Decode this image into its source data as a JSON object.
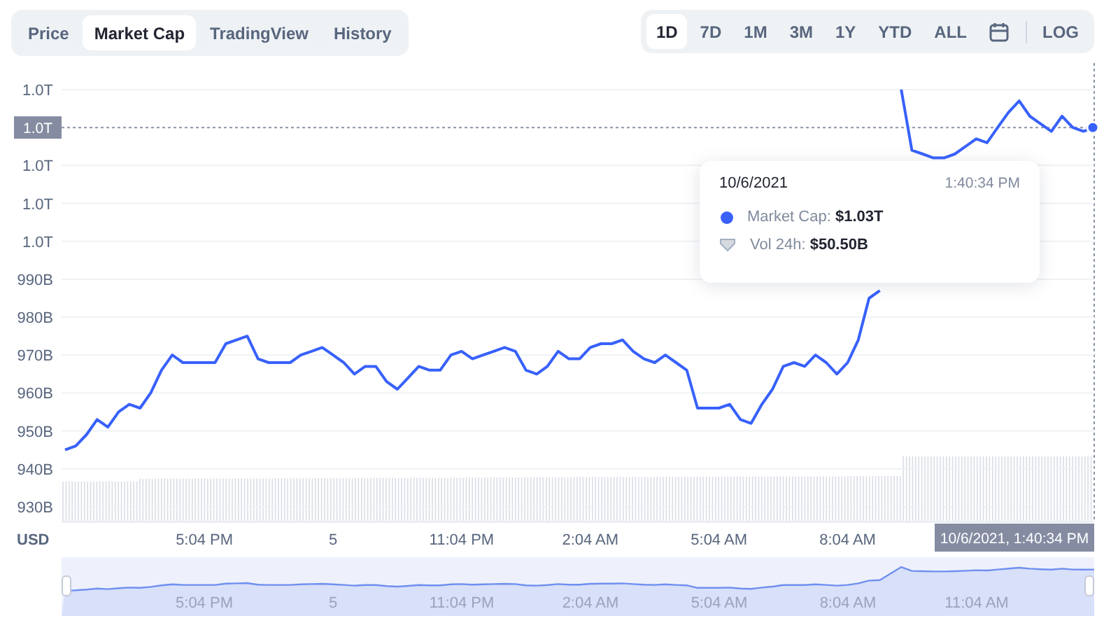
{
  "tabs": [
    {
      "label": "Price",
      "selected": false
    },
    {
      "label": "Market Cap",
      "selected": true
    },
    {
      "label": "TradingView",
      "selected": false
    },
    {
      "label": "History",
      "selected": false
    }
  ],
  "ranges": [
    {
      "label": "1D",
      "selected": true
    },
    {
      "label": "7D",
      "selected": false
    },
    {
      "label": "1M",
      "selected": false
    },
    {
      "label": "3M",
      "selected": false
    },
    {
      "label": "1Y",
      "selected": false
    },
    {
      "label": "YTD",
      "selected": false
    },
    {
      "label": "ALL",
      "selected": false
    }
  ],
  "scale_toggle": {
    "label": "LOG"
  },
  "chart": {
    "currency": "USD",
    "crosshair": {
      "y_label": "1.0T",
      "x_label": "10/6/2021, 1:40:34 PM"
    },
    "tooltip": {
      "date": "10/6/2021",
      "time": "1:40:34 PM",
      "rows": [
        {
          "kind": "series",
          "text": "Market Cap: **$1.03T**"
        },
        {
          "kind": "volume",
          "text": "Vol 24h: **$50.50B**"
        }
      ]
    },
    "chart_data": {
      "type": "line",
      "grid": true,
      "ylim": [
        926000000000,
        1040000000000
      ],
      "categories": [
        null,
        null,
        null,
        null,
        null,
        null,
        null,
        null,
        null,
        null,
        null,
        null,
        null,
        "5:04 PM",
        null,
        null,
        null,
        null,
        null,
        null,
        null,
        null,
        null,
        null,
        null,
        "5",
        null,
        null,
        null,
        null,
        null,
        null,
        null,
        null,
        null,
        null,
        null,
        "11:04 PM",
        null,
        null,
        null,
        null,
        null,
        null,
        null,
        null,
        null,
        null,
        null,
        "2:04 AM",
        null,
        null,
        null,
        null,
        null,
        null,
        null,
        null,
        null,
        null,
        null,
        "5:04 AM",
        null,
        null,
        null,
        null,
        null,
        null,
        null,
        null,
        null,
        null,
        null,
        "8:04 AM",
        null,
        null,
        null,
        null,
        null,
        null,
        null,
        null,
        null,
        null,
        null,
        null,
        null,
        null,
        null,
        null,
        null,
        null,
        null,
        null,
        null,
        null,
        null
      ],
      "yticks": [
        {
          "value": 930000000000,
          "label": "930B"
        },
        {
          "value": 940000000000,
          "label": "940B"
        },
        {
          "value": 950000000000,
          "label": "950B"
        },
        {
          "value": 960000000000,
          "label": "960B"
        },
        {
          "value": 970000000000,
          "label": "970B"
        },
        {
          "value": 980000000000,
          "label": "980B"
        },
        {
          "value": 990000000000,
          "label": "990B"
        },
        {
          "value": 1000000000000,
          "label": "1.0T"
        },
        {
          "value": 1010000000000,
          "label": "1.0T"
        },
        {
          "value": 1020000000000,
          "label": "1.0T"
        },
        {
          "value": 1040000000000,
          "label": "1.0T"
        }
      ],
      "series": [
        {
          "color": "#3861fb",
          "values": [
            945000000000,
            946000000000,
            949000000000,
            953000000000,
            951000000000,
            955000000000,
            957000000000,
            956000000000,
            960000000000,
            966000000000,
            970000000000,
            968000000000,
            968000000000,
            968000000000,
            968000000000,
            973000000000,
            974000000000,
            975000000000,
            969000000000,
            968000000000,
            968000000000,
            968000000000,
            970000000000,
            971000000000,
            972000000000,
            970000000000,
            968000000000,
            965000000000,
            967000000000,
            967000000000,
            963000000000,
            961000000000,
            964000000000,
            967000000000,
            966000000000,
            966000000000,
            970000000000,
            971000000000,
            969000000000,
            970000000000,
            971000000000,
            972000000000,
            971000000000,
            966000000000,
            965000000000,
            967000000000,
            971000000000,
            969000000000,
            969000000000,
            972000000000,
            973000000000,
            973000000000,
            974000000000,
            971000000000,
            969000000000,
            968000000000,
            970000000000,
            968000000000,
            966000000000,
            956000000000,
            956000000000,
            956000000000,
            957000000000,
            953000000000,
            952000000000,
            957000000000,
            961000000000,
            967000000000,
            968000000000,
            967000000000,
            970000000000,
            968000000000,
            965000000000,
            968000000000,
            974000000000,
            985000000000,
            987000000000,
            null,
            1040000000000,
            1024000000000,
            1023000000000,
            1022000000000,
            1022000000000,
            1023000000000,
            1025000000000,
            1027000000000,
            1026000000000,
            1030000000000,
            1034000000000,
            1037000000000,
            1033000000000,
            1031000000000,
            1029000000000,
            1033000000000,
            1030000000000,
            1029000000000,
            1030000000000
          ]
        }
      ]
    }
  },
  "navigator": {
    "labels": [
      "5:04 PM",
      "5",
      "11:04 PM",
      "2:04 AM",
      "5:04 AM",
      "8:04 AM",
      "11:04 AM"
    ]
  }
}
